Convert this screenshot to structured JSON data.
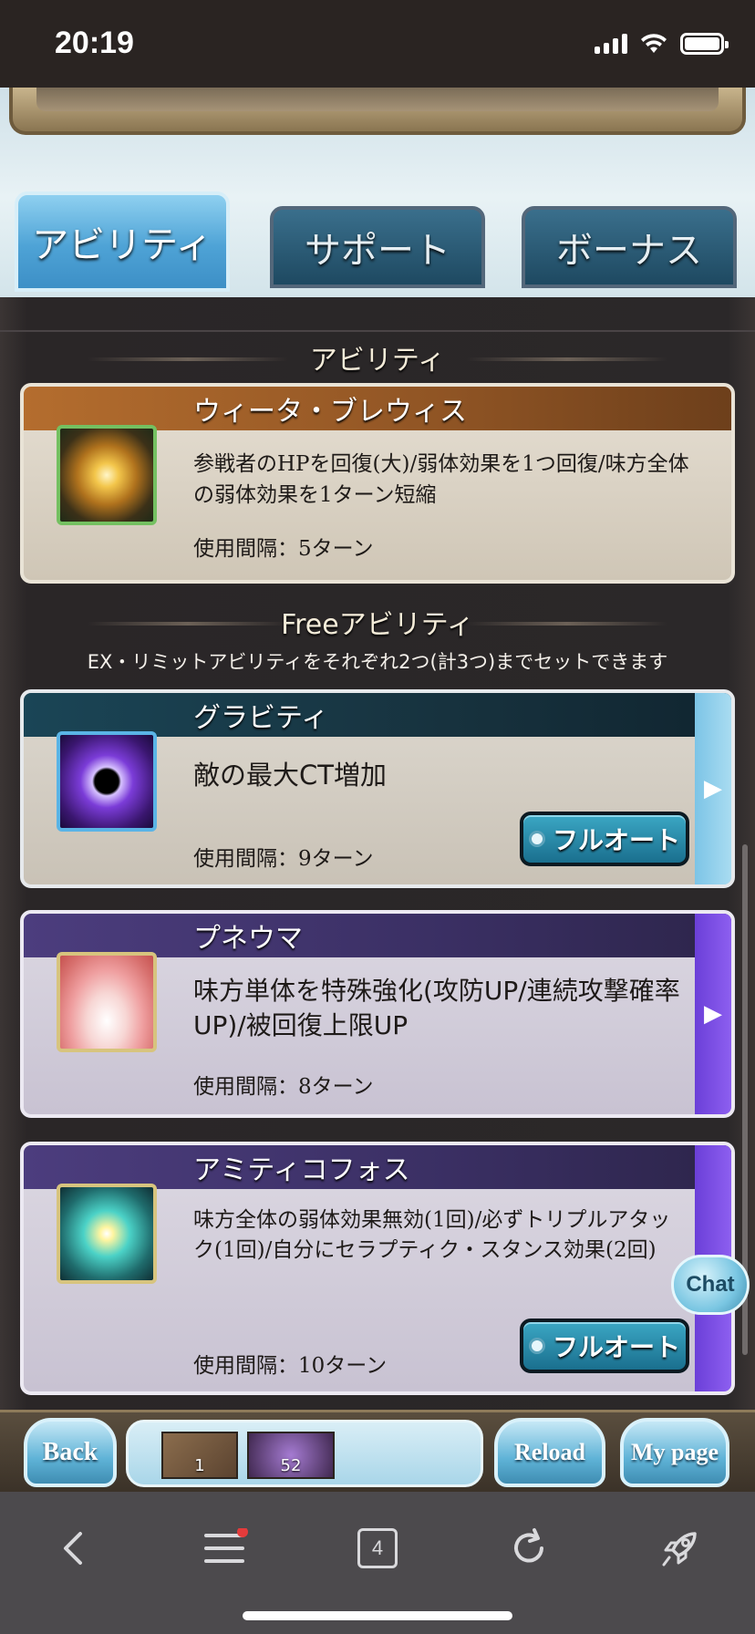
{
  "status": {
    "time": "20:19"
  },
  "tabs": [
    {
      "label": "アビリティ",
      "active": true
    },
    {
      "label": "サポート",
      "active": false
    },
    {
      "label": "ボーナス",
      "active": false
    }
  ],
  "sections": {
    "ability_title": "アビリティ",
    "free_title": "Freeアビリティ",
    "free_subtitle": "EX・リミットアビリティをそれぞれ2つ(計3つ)までセットできます"
  },
  "abilities": [
    {
      "name": "ウィータ・ブレウィス",
      "description": "参戦者のHPを回復(大)/弱体効果を1つ回復/味方全体の弱体効果を1ターン短縮",
      "cooldown": "使用間隔：5ターン",
      "icon": "heal-burst-icon"
    },
    {
      "name": "グラビティ",
      "description": "敵の最大CT増加",
      "cooldown": "使用間隔：9ターン",
      "icon": "gravity-orb-icon",
      "auto_label": "フルオート"
    },
    {
      "name": "プネウマ",
      "description": "味方単体を特殊強化(攻防UP/連続攻撃確率UP)/被回復上限UP",
      "cooldown": "使用間隔：8ターン",
      "icon": "praying-hands-icon"
    },
    {
      "name": "アミティコフォス",
      "description": "味方全体の弱体効果無効(1回)/必ずトリプルアタック(1回)/自分にセラプティク・スタンス効果(2回)",
      "cooldown": "使用間隔：10ターン",
      "icon": "star-ring-icon",
      "auto_label": "フルオート"
    }
  ],
  "chat": {
    "label": "Chat"
  },
  "footer": {
    "back_label": "Back",
    "reload_label": "Reload",
    "mypage_label": "My page",
    "item_count_1": "1",
    "item_count_2": "52"
  },
  "browser": {
    "tab_count": "4"
  },
  "colors": {
    "accent_blue": "#4ea3d6",
    "header_brown": "#8f5424",
    "header_purple": "#3a2f63",
    "header_teal": "#17323e"
  }
}
